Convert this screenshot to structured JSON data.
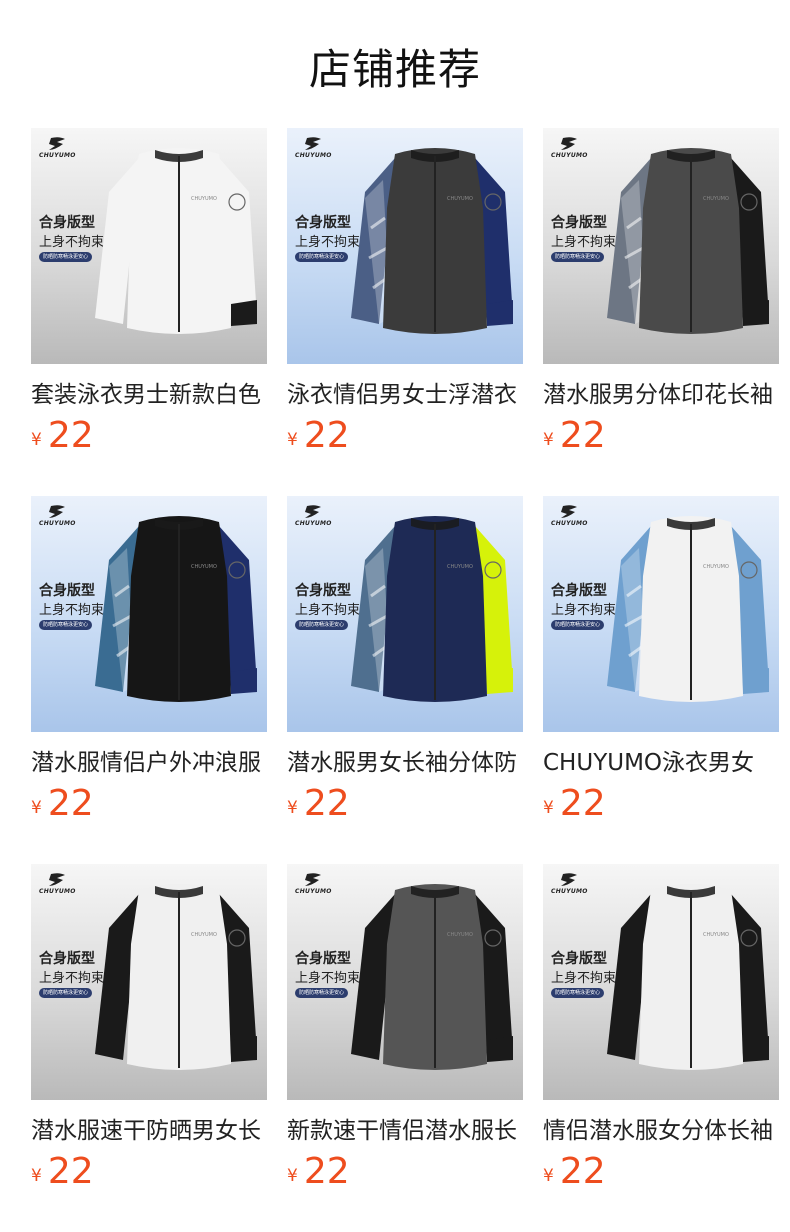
{
  "section_title": "店铺推荐",
  "brand_word": "CHUYUMO",
  "promo": {
    "line1": "合身版型",
    "line2": "上身不拘束",
    "badge": "防晒防寒畅泳更安心"
  },
  "currency": "¥",
  "products": [
    {
      "name": "套装泳衣男士新款白色",
      "price": "22",
      "bg": "grey",
      "body": "#f4f4f4",
      "sleeve_l": "#f4f4f4",
      "sleeve_r": "#f4f4f4",
      "cuff": "#1b1b1b",
      "pattern": false
    },
    {
      "name": "泳衣情侣男女士浮潜衣",
      "price": "22",
      "bg": "blue",
      "body": "#3b3b3b",
      "sleeve_l": "#4b5f86",
      "sleeve_r": "#1f2f6b",
      "cuff": "#1f2f6b",
      "pattern": true
    },
    {
      "name": "潜水服男分体印花长袖",
      "price": "22",
      "bg": "grey",
      "body": "#4a4a4a",
      "sleeve_l": "#6d7684",
      "sleeve_r": "#1a1a1a",
      "cuff": "#1a1a1a",
      "pattern": true
    },
    {
      "name": "潜水服情侣户外冲浪服",
      "price": "22",
      "bg": "blue",
      "body": "#161616",
      "sleeve_l": "#3a6c92",
      "sleeve_r": "#1f2f6b",
      "cuff": "#1f2f6b",
      "pattern": true
    },
    {
      "name": "潜水服男女长袖分体防",
      "price": "22",
      "bg": "blue",
      "body": "#1e2a55",
      "sleeve_l": "#4f6f8f",
      "sleeve_r": "#d6f20a",
      "cuff": "#d6f20a",
      "pattern": true
    },
    {
      "name": "CHUYUMO泳衣男女",
      "price": "22",
      "bg": "blue",
      "body": "#f2f2f2",
      "sleeve_l": "#6fa0cf",
      "sleeve_r": "#6fa0cf",
      "cuff": "#6fa0cf",
      "pattern": true
    },
    {
      "name": "潜水服速干防晒男女长",
      "price": "22",
      "bg": "grey",
      "body": "#f0f0f0",
      "sleeve_l": "#1a1a1a",
      "sleeve_r": "#1a1a1a",
      "cuff": "#1a1a1a",
      "pattern": false
    },
    {
      "name": "新款速干情侣潜水服长",
      "price": "22",
      "bg": "grey",
      "body": "#555555",
      "sleeve_l": "#1a1a1a",
      "sleeve_r": "#1a1a1a",
      "cuff": "#1a1a1a",
      "pattern": false
    },
    {
      "name": "情侣潜水服女分体长袖",
      "price": "22",
      "bg": "grey",
      "body": "#f0f0f0",
      "sleeve_l": "#1a1a1a",
      "sleeve_r": "#1a1a1a",
      "cuff": "#1a1a1a",
      "pattern": false
    }
  ]
}
